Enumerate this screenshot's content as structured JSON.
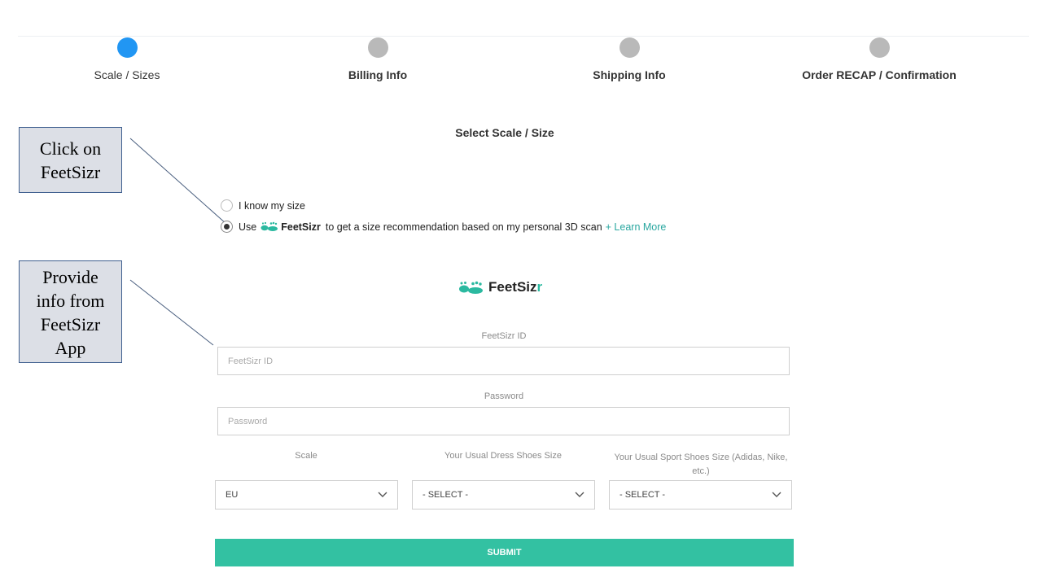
{
  "steps": [
    {
      "label": "Scale / Sizes",
      "state": "active"
    },
    {
      "label": "Billing Info",
      "state": "inactive"
    },
    {
      "label": "Shipping Info",
      "state": "inactive"
    },
    {
      "label": "Order RECAP / Confirmation",
      "state": "inactive"
    }
  ],
  "section_title": "Select Scale / Size",
  "callouts": {
    "first": {
      "line1": "Click on",
      "line2": "FeetSizr"
    },
    "second": {
      "line1": "Provide",
      "line2": "info from",
      "line3": "FeetSizr",
      "line4": "App"
    }
  },
  "options": {
    "know_size": {
      "label": "I know my size",
      "selected": false
    },
    "use_app": {
      "prefix": "Use",
      "brand": "FeetSizr",
      "suffix": "to get a size recommendation based on my personal 3D scan",
      "learn_more": "+ Learn More",
      "selected": true
    }
  },
  "brand": {
    "name_main": "FeetSiz",
    "name_accent": "r",
    "inline_name": "FeetSizr",
    "icon": "footprints-icon",
    "accent_color": "#2bb9a0"
  },
  "form": {
    "id_label": "FeetSizr ID",
    "id_placeholder": "FeetSizr ID",
    "password_label": "Password",
    "password_placeholder": "Password",
    "scale_label": "Scale",
    "scale_value": "EU",
    "dress_label": "Your Usual Dress Shoes Size",
    "dress_value": "- SELECT -",
    "sport_label": "Your Usual Sport Shoes Size (Adidas, Nike, etc.)",
    "sport_value": "- SELECT -",
    "submit_label": "SUBMIT"
  },
  "colors": {
    "active_step": "#2196f3",
    "inactive_step": "#b9b9b9",
    "submit": "#33c1a2",
    "learn_more": "#2aa7a0"
  }
}
